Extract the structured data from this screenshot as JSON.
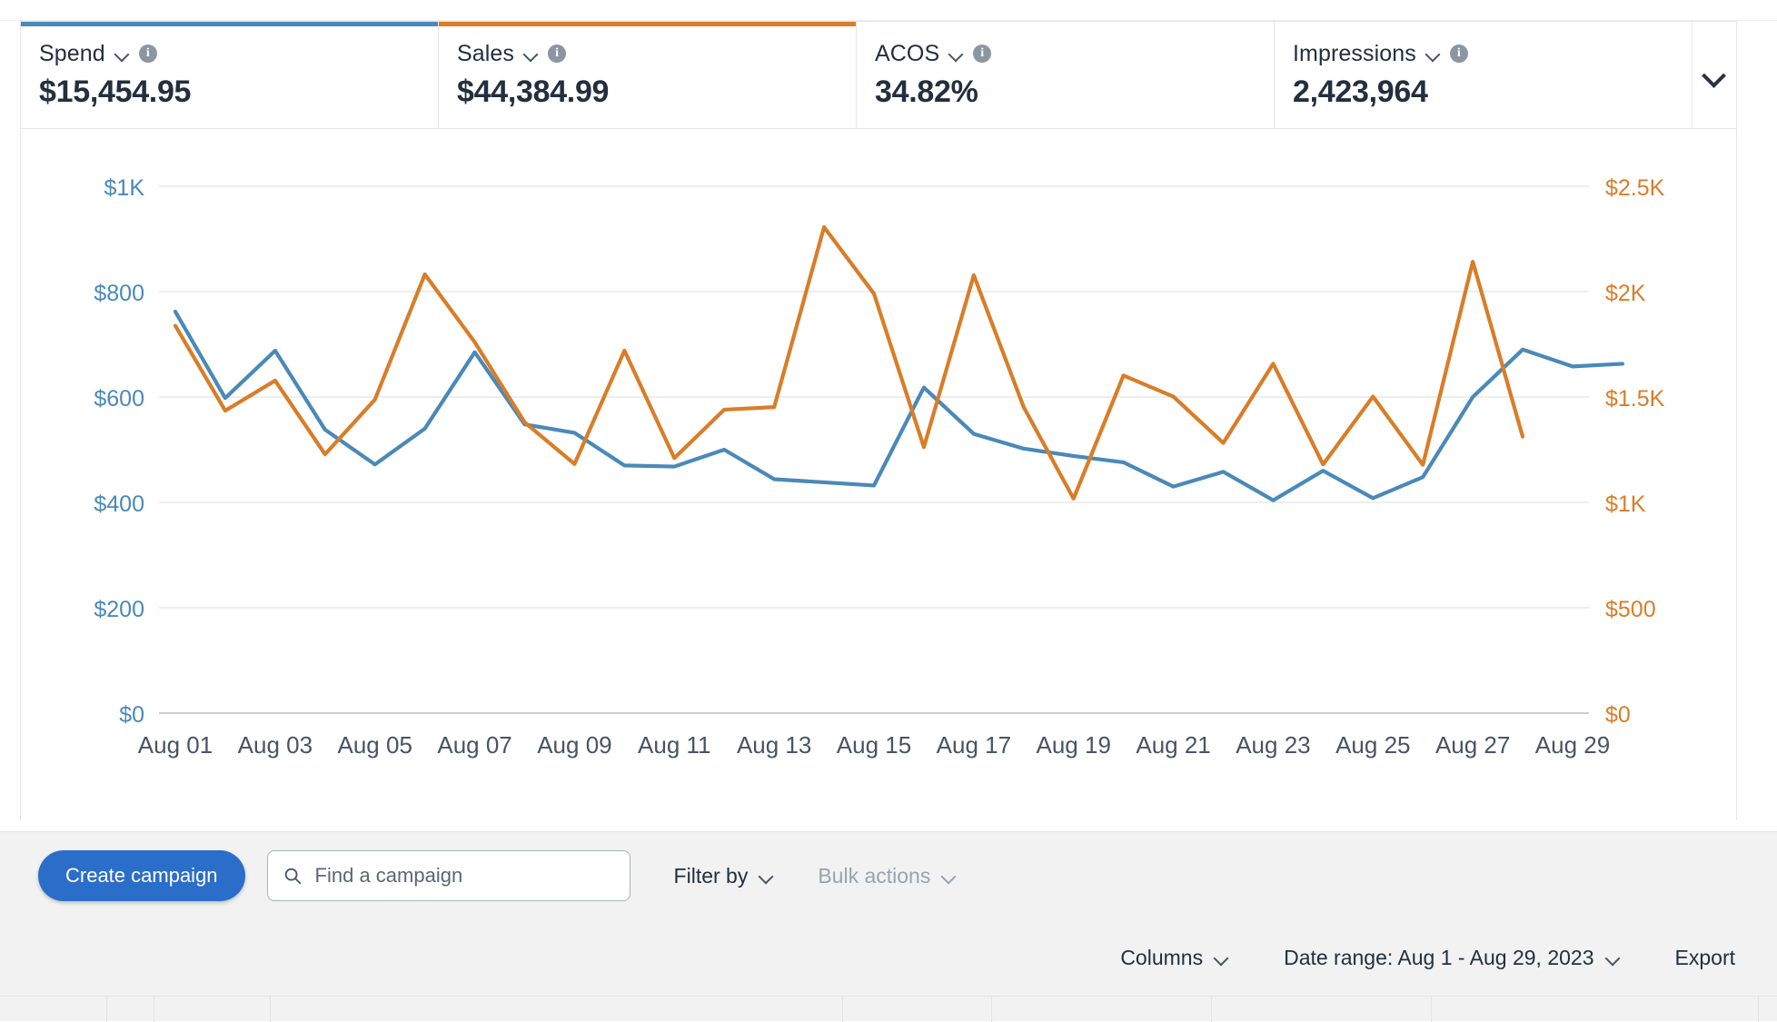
{
  "metrics": [
    {
      "label": "Spend",
      "value": "$15,454.95",
      "accent": "#4a89b8",
      "info": "i",
      "chevron": "chevron-down-icon"
    },
    {
      "label": "Sales",
      "value": "$44,384.99",
      "accent": "#d97d28",
      "info": "i",
      "chevron": "chevron-down-icon"
    },
    {
      "label": "ACOS",
      "value": "34.82%",
      "accent": "#ffffff",
      "info": "i",
      "chevron": "chevron-down-icon"
    },
    {
      "label": "Impressions",
      "value": "2,423,964",
      "accent": "#ffffff",
      "info": "i",
      "chevron": "chevron-down-icon"
    }
  ],
  "expand": {
    "icon": "chevron-down-icon"
  },
  "toolbar": {
    "create_label": "Create campaign",
    "search_placeholder": "Find a campaign",
    "search_value": "",
    "filter_label": "Filter by",
    "bulk_label": "Bulk actions",
    "columns_label": "Columns",
    "date_range_label": "Date range: Aug 1 - Aug 29, 2023",
    "export_label": "Export"
  },
  "chart_data": {
    "type": "line",
    "title": "",
    "xlabel": "",
    "grid": true,
    "legend": "none",
    "x": [
      "Aug 01",
      "Aug 02",
      "Aug 03",
      "Aug 04",
      "Aug 05",
      "Aug 06",
      "Aug 07",
      "Aug 08",
      "Aug 09",
      "Aug 10",
      "Aug 11",
      "Aug 12",
      "Aug 13",
      "Aug 14",
      "Aug 15",
      "Aug 16",
      "Aug 17",
      "Aug 18",
      "Aug 19",
      "Aug 20",
      "Aug 21",
      "Aug 22",
      "Aug 23",
      "Aug 24",
      "Aug 25",
      "Aug 26",
      "Aug 27",
      "Aug 28",
      "Aug 29"
    ],
    "xtick_labels": [
      "Aug 01",
      "Aug 03",
      "Aug 05",
      "Aug 07",
      "Aug 09",
      "Aug 11",
      "Aug 13",
      "Aug 15",
      "Aug 17",
      "Aug 19",
      "Aug 21",
      "Aug 23",
      "Aug 25",
      "Aug 27",
      "Aug 29"
    ],
    "left_axis": {
      "label": "Spend",
      "color": "#4a89b8",
      "ylim": [
        0,
        1000
      ],
      "ticks": [
        0,
        200,
        400,
        600,
        800,
        1000
      ],
      "tick_labels": [
        "$0",
        "$200",
        "$400",
        "$600",
        "$800",
        "$1K"
      ]
    },
    "right_axis": {
      "label": "Sales",
      "color": "#d97d28",
      "ylim": [
        0,
        2500
      ],
      "ticks": [
        0,
        500,
        1000,
        1500,
        2000,
        2500
      ],
      "tick_labels": [
        "$0",
        "$500",
        "$1K",
        "$1.5K",
        "$2K",
        "$2.5K"
      ]
    },
    "series": [
      {
        "name": "Spend",
        "axis": "left",
        "color": "#4a89b8",
        "values": [
          762,
          598,
          688,
          538,
          472,
          540,
          685,
          548,
          532,
          470,
          468,
          500,
          444,
          438,
          432,
          618,
          530,
          502,
          488,
          476,
          430,
          458,
          404,
          460,
          408,
          448,
          600,
          690,
          658,
          663
        ]
      },
      {
        "name": "Sales",
        "axis": "right",
        "color": "#d97d28",
        "values": [
          1838,
          1435,
          1578,
          1228,
          1488,
          2082,
          1760,
          1380,
          1182,
          1720,
          1210,
          1440,
          1452,
          2306,
          1990,
          1262,
          2078,
          1452,
          1018,
          1602,
          1502,
          1282,
          1658,
          1180,
          1502,
          1178,
          2142,
          1312
        ]
      }
    ]
  },
  "table_header": {
    "columns": [
      "",
      "",
      "",
      "",
      "",
      "",
      ""
    ]
  }
}
